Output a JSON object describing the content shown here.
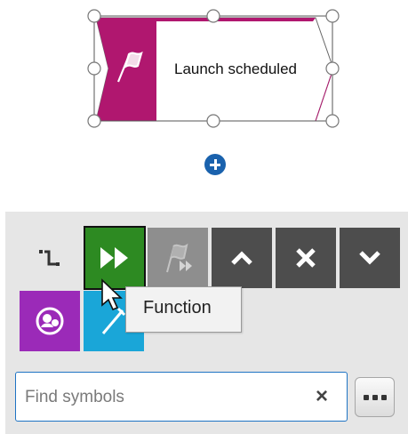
{
  "canvas": {
    "event": {
      "label": "Launch scheduled",
      "color": "#b0176f"
    },
    "add_button": {
      "icon": "plus-circle-icon"
    }
  },
  "toolbar": {
    "buttons": [
      {
        "name": "connector-tool",
        "icon": "connector-icon"
      },
      {
        "name": "function",
        "icon": "fast-forward-icon",
        "color": "#2d8a22"
      },
      {
        "name": "event-function",
        "icon": "flag-forward-icon",
        "color": "#8e8e8e"
      },
      {
        "name": "move-up",
        "icon": "chevron-up-icon",
        "color": "#4d4d4d"
      },
      {
        "name": "delete",
        "icon": "close-icon",
        "color": "#4d4d4d"
      },
      {
        "name": "move-down",
        "icon": "chevron-down-icon",
        "color": "#4d4d4d"
      },
      {
        "name": "organizational-unit",
        "icon": "org-unit-icon",
        "color": "#9b2ab8"
      },
      {
        "name": "document",
        "icon": "document-icon",
        "color": "#1aa6d8"
      }
    ],
    "tooltip": "Function"
  },
  "search": {
    "placeholder": "Find symbols",
    "value": "",
    "clear_icon": "×"
  },
  "more_button": {
    "icon": "ellipsis-icon"
  }
}
